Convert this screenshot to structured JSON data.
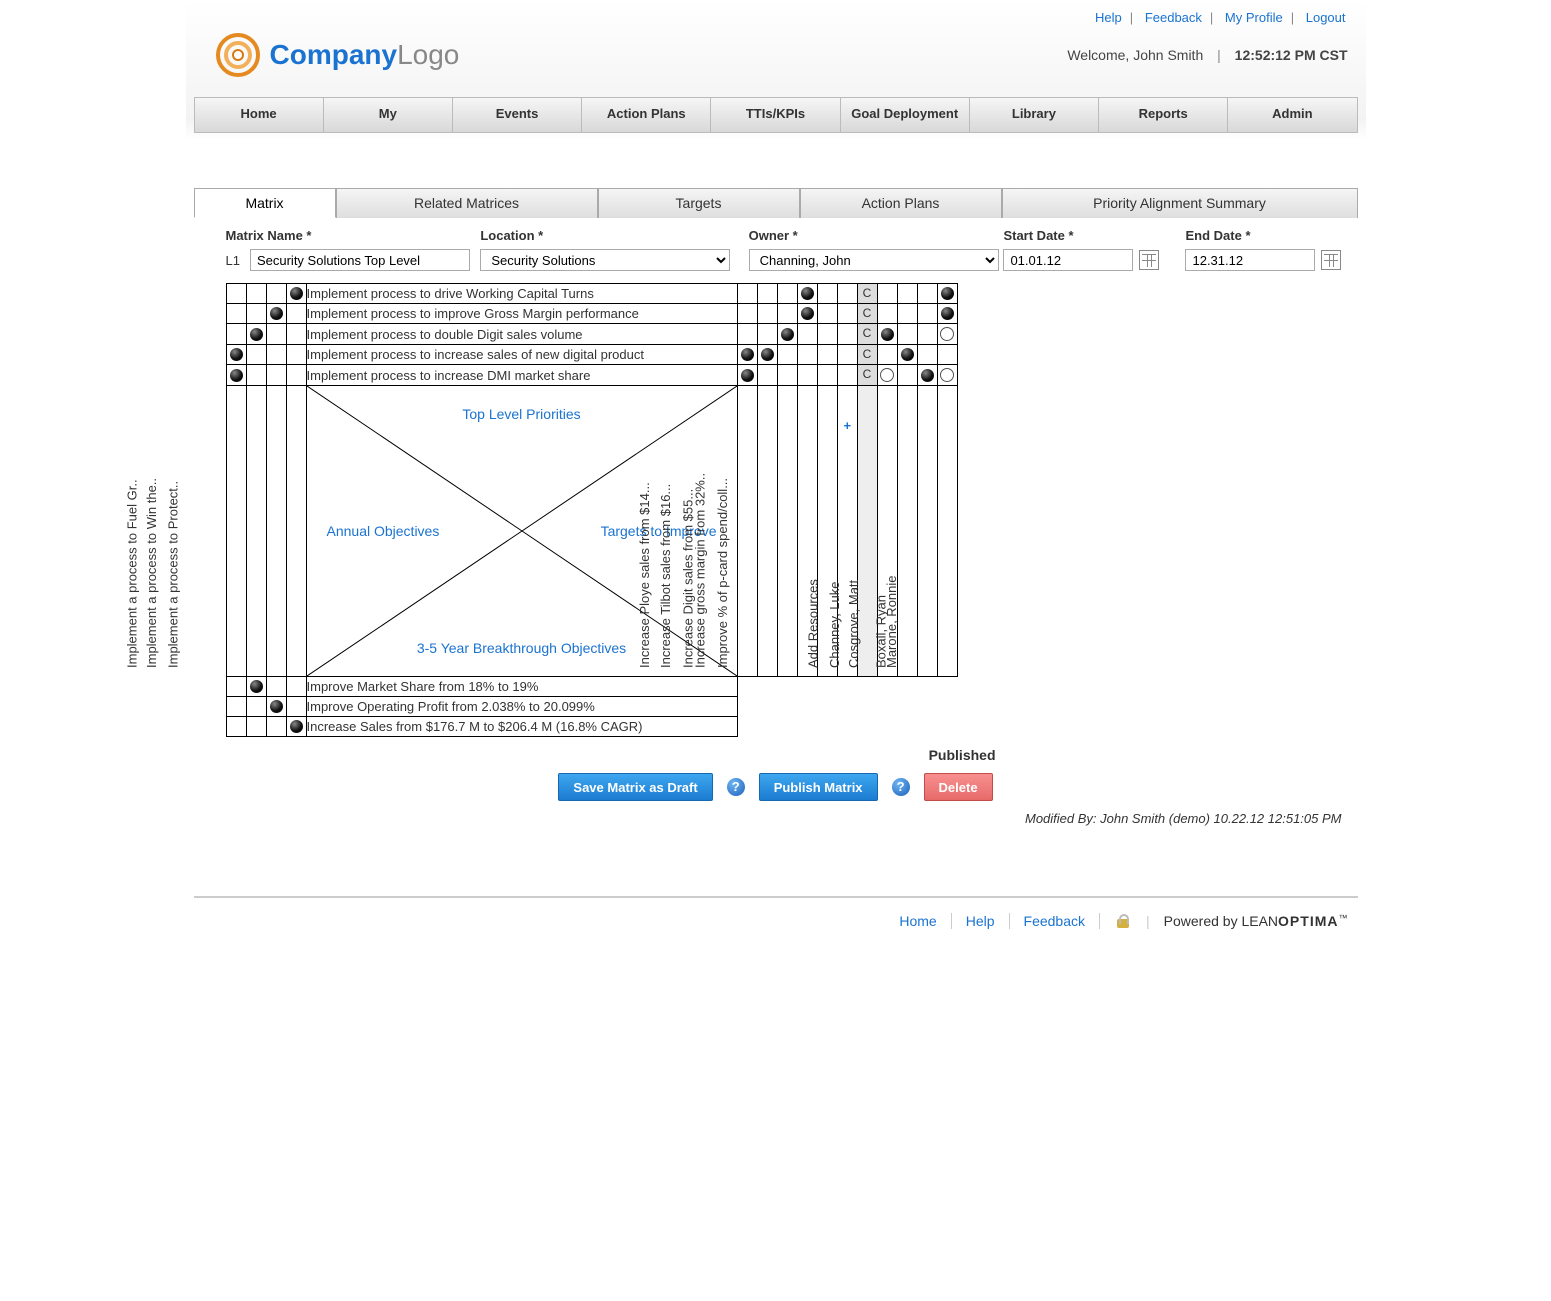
{
  "top_links": {
    "help": "Help",
    "feedback": "Feedback",
    "my_profile": "My Profile",
    "logout": "Logout"
  },
  "logo": {
    "brand1": "Company",
    "brand2": "Logo"
  },
  "welcome": {
    "prefix": "Welcome, ",
    "user": "John Smith",
    "time": "12:52:12 PM CST"
  },
  "nav": [
    "Home",
    "My",
    "Events",
    "Action Plans",
    "TTIs/KPIs",
    "Goal Deployment",
    "Library",
    "Reports",
    "Admin"
  ],
  "tabs": [
    "Matrix",
    "Related Matrices",
    "Targets",
    "Action Plans",
    "Priority Alignment Summary"
  ],
  "fields": {
    "matrix_name_label": "Matrix Name *",
    "location_label": "Location *",
    "owner_label": "Owner *",
    "start_label": "Start Date *",
    "end_label": "End Date *",
    "level": "L1",
    "matrix_name": "Security Solutions Top Level",
    "location": "Security Solutions",
    "owner": "Channing, John",
    "start": "01.01.12",
    "end": "12.31.12"
  },
  "top_rows": [
    {
      "text": "Implement process to drive Working Capital Turns",
      "left": [
        0,
        0,
        0,
        1
      ],
      "cols": [
        0,
        0,
        0,
        1,
        0
      ],
      "c": "C",
      "res": [
        0,
        0,
        0,
        1
      ]
    },
    {
      "text": "Implement process to improve Gross Margin performance",
      "left": [
        0,
        0,
        1,
        0
      ],
      "cols": [
        0,
        0,
        0,
        1,
        0
      ],
      "c": "C",
      "res": [
        0,
        0,
        0,
        1
      ]
    },
    {
      "text": "Implement process to double Digit sales volume",
      "left": [
        0,
        1,
        0,
        0
      ],
      "cols": [
        0,
        0,
        1,
        0,
        0
      ],
      "c": "C",
      "res": [
        1,
        0,
        0,
        2
      ]
    },
    {
      "text": "Implement process to increase sales of new digital product",
      "left": [
        1,
        0,
        0,
        0
      ],
      "cols": [
        1,
        1,
        0,
        0,
        0
      ],
      "c": "C",
      "res": [
        0,
        1,
        0,
        0
      ]
    },
    {
      "text": "Implement process to increase DMI market share",
      "left": [
        1,
        0,
        0,
        0
      ],
      "cols": [
        1,
        0,
        0,
        0,
        0
      ],
      "c": "C",
      "res": [
        2,
        0,
        1,
        2
      ]
    }
  ],
  "left_processes": [
    "Implement a process to Fuel Gr..",
    "Implement a process to Win the..",
    "Implement a process to Protect.."
  ],
  "center_labels": {
    "top": "Top Level Priorities",
    "left": "Annual Objectives",
    "right": "Targets to Improve",
    "bottom": "3-5 Year Breakthrough Objectives"
  },
  "targets_cols": [
    "Increase Ploye sales from $14...",
    "Increase Tilbot sales from $16...",
    "Increase Digit sales from $55...",
    "Increase gross margin from 32%..",
    "Improve % of p-card spend/coll..."
  ],
  "add_resources_label": "Add Resources",
  "resource_cols": [
    "Channey, Luke",
    "Cosgrove, Matt",
    "Boxall, Ryan",
    "Marone, Ronnie"
  ],
  "bottom_rows": [
    {
      "text": "Improve Market Share from 18% to 19%",
      "left": [
        0,
        1,
        0,
        0
      ]
    },
    {
      "text": "Improve Operating Profit from 2.038% to 20.099%",
      "left": [
        0,
        0,
        1,
        0
      ]
    },
    {
      "text": "Increase Sales from $176.7 M to $206.4 M (16.8% CAGR)",
      "left": [
        0,
        0,
        0,
        1
      ]
    }
  ],
  "status_label": "Published",
  "buttons": {
    "save": "Save Matrix as Draft",
    "publish": "Publish Matrix",
    "delete": "Delete"
  },
  "modified": "Modified By: John Smith (demo)  10.22.12 12:51:05 PM",
  "footer": {
    "home": "Home",
    "help": "Help",
    "feedback": "Feedback",
    "powered_prefix": "Powered by "
  }
}
